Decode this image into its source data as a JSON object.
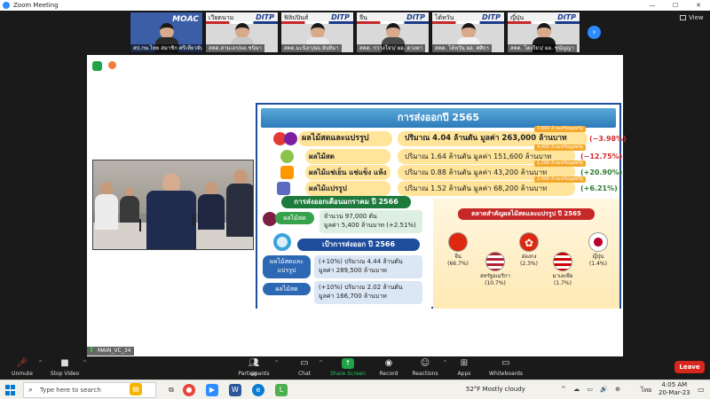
{
  "window": {
    "title": "Zoom Meeting",
    "controls": [
      "—",
      "☐",
      "✕"
    ]
  },
  "gallery": {
    "view_label": "View",
    "tiles": [
      {
        "name": "สป.กษ.ไทย สมาชิก ศรีเที่ยวจันทร์",
        "header": "",
        "brand": "MOAC"
      },
      {
        "name": "สคต.สามเอร/ผอ.ชนิษา",
        "header": "เวียดนาม",
        "brand": "DITP"
      },
      {
        "name": "สคต.มะนิลา/ผอ.จันทิมา",
        "header": "ฟิลิปปินส์",
        "brand": "DITP"
      },
      {
        "name": "สคต. กวางโจว/ ผอ. ดวงตา",
        "header": "จีน",
        "brand": "DITP"
      },
      {
        "name": "สคต. ไต้หวัน ผอ. ศศิธร",
        "header": "ไต้หวัน",
        "brand": "DITP"
      },
      {
        "name": "สคต. โตเกียว/ ผอ. ชนัญญา",
        "header": "ญี่ปุ่น",
        "brand": "DITP"
      }
    ]
  },
  "share_name": "MAIN_VC_34",
  "slide": {
    "title": "การส่งออกปี 2565",
    "rows": [
      {
        "label": "ผลไม้สดและแปรรูป",
        "value": "ปริมาณ 4.04 ล้านตัน มูลค่า 263,000 ล้านบาท",
        "tag": "7,600 ล้านเหรียญสหรัฐ",
        "pct": "(−3.98%)",
        "pct_color": "#d32f2f"
      },
      {
        "label": "ผลไม้สด",
        "value": "ปริมาณ 1.64 ล้านตัน มูลค่า 151,600 ล้านบาท",
        "tag": "4,400 ล้านเหรียญสหรัฐ",
        "pct": "(−12.75%)",
        "pct_color": "#d32f2f"
      },
      {
        "label": "ผลไม้แช่เย็น แช่แข็ง แห้ง",
        "value": "ปริมาณ 0.88 ล้านตัน มูลค่า 43,200 ล้านบาท",
        "tag": "1,200 ล้านเหรียญสหรัฐ",
        "pct": "(+20.90%)",
        "pct_color": "#2e7d32"
      },
      {
        "label": "ผลไม้แปรรูป",
        "value": "ปริมาณ 1.52 ล้านตัน มูลค่า 68,200 ล้านบาท",
        "tag": "2,000 ล้านเหรียญสหรัฐ",
        "pct": "(+6.21%)",
        "pct_color": "#2e7d32"
      }
    ],
    "jan": {
      "title": "การส่งออกเดือนมกราคม ปี 2566",
      "label": "ผลไม้สด",
      "line1": "จำนวน 97,000 ตัน",
      "line2": "มูลค่า 5,400 ล้านบาท (+2.51%)"
    },
    "target": {
      "title": "เป้าการส่งออก ปี 2566",
      "items": [
        {
          "label": "ผลไม้สดและแปรรูป",
          "line1": "(+10%) ปริมาณ 4.44 ล้านตัน",
          "line2": "มูลค่า 289,500 ล้านบาท"
        },
        {
          "label": "ผลไม้สด",
          "line1": "(+10%) ปริมาณ 2.02 ล้านตัน",
          "line2": "มูลค่า 166,700 ล้านบาท"
        }
      ]
    },
    "markets": {
      "title": "ตลาดสำคัญผลไม้สดและแปรรูป ปี 2565",
      "countries": [
        {
          "name": "จีน",
          "pct": "(66.7%)",
          "flag": "cn"
        },
        {
          "name": "สหรัฐอเมริกา",
          "pct": "(10.7%)",
          "flag": "us"
        },
        {
          "name": "ฮ่องกง",
          "pct": "(2.3%)",
          "flag": "hk"
        },
        {
          "name": "มาเลเซีย",
          "pct": "(1.7%)",
          "flag": "my"
        },
        {
          "name": "ญี่ปุ่น",
          "pct": "(1.4%)",
          "flag": "jp"
        }
      ]
    }
  },
  "toolbar": {
    "unmute": "Unmute",
    "stop_video": "Stop Video",
    "participants": "Participants",
    "participants_count": "80",
    "chat": "Chat",
    "share_screen": "Share Screen",
    "record": "Record",
    "reactions": "Reactions",
    "apps": "Apps",
    "whiteboards": "Whiteboards",
    "leave": "Leave"
  },
  "taskbar": {
    "search_placeholder": "Type here to search",
    "weather": "52°F  Mostly cloudy",
    "tray": "^ ☁ ▭ 🔊 ⊕",
    "lang": "ไทย",
    "time": "4:05 AM",
    "date": "20-Mar-23"
  },
  "colors": {
    "accent": "#2d8cff",
    "leave": "#d8281e",
    "share_green": "#21a34a"
  }
}
